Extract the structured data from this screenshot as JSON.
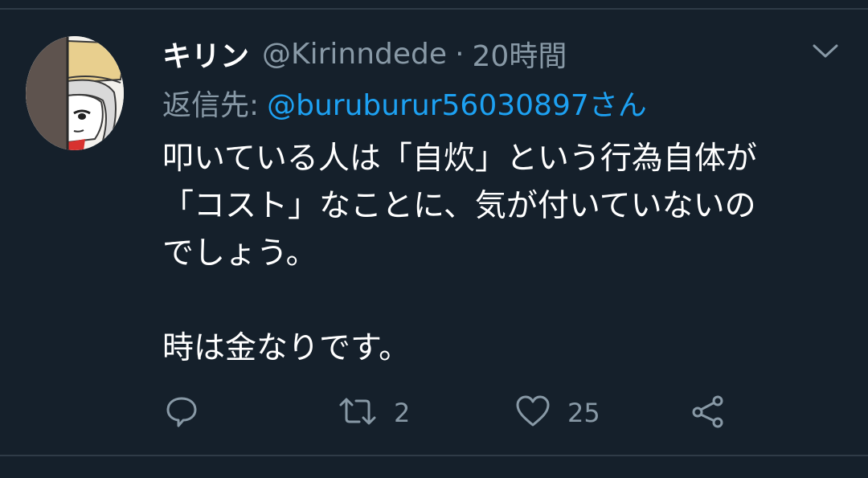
{
  "tweet": {
    "display_name": "キリン",
    "handle": "@Kirinndede",
    "separator": "·",
    "time": "20時間",
    "reply_prefix": "返信先:",
    "reply_to": "@buruburur56030897さん",
    "body": "叩いている人は「自炊」という行為自体が\n「コスト」なことに、気が付いていないの\nでしょう。\n\n時は金なりです。",
    "retweet_count": "2",
    "like_count": "25"
  },
  "icons": {
    "caret": "chevron-down-icon",
    "reply": "comment-icon",
    "retweet": "retweet-icon",
    "like": "heart-icon",
    "share": "share-icon"
  },
  "colors": {
    "background": "#15202b",
    "secondary_text": "#8899a6",
    "link": "#1da1f2",
    "divider": "#2f3b47"
  }
}
